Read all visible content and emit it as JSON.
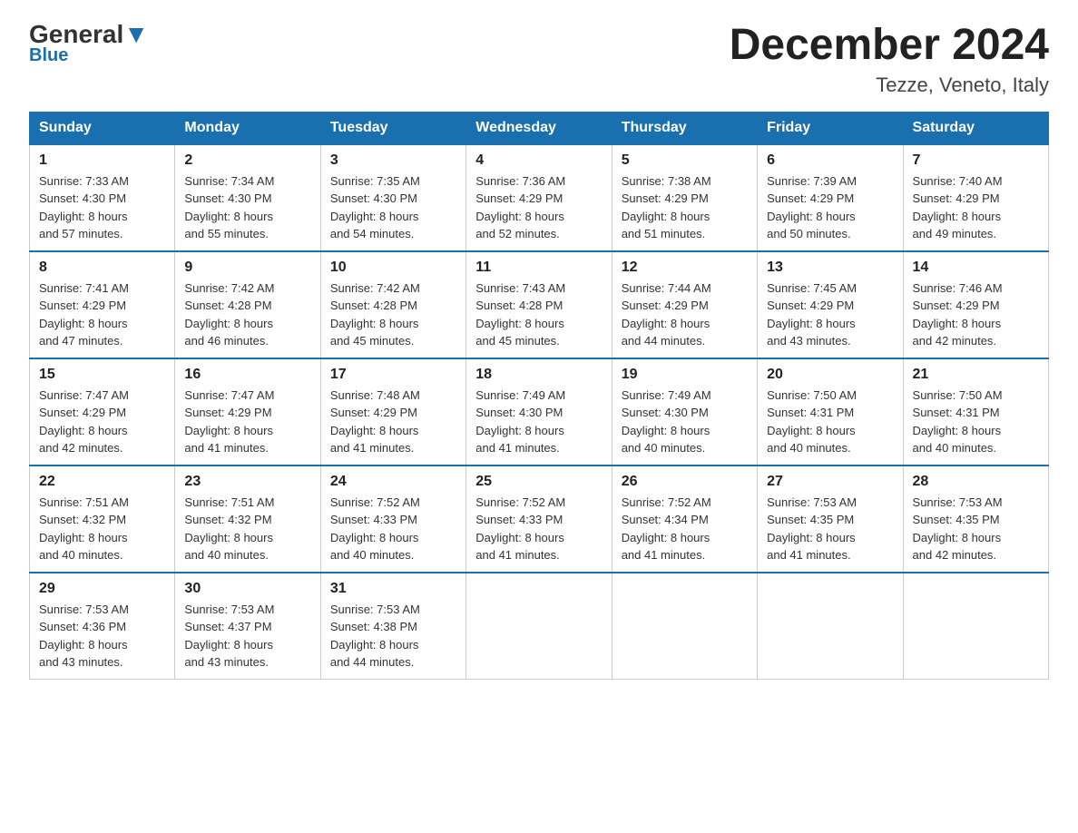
{
  "logo": {
    "general": "General",
    "triangle": "",
    "blue": "Blue"
  },
  "title": "December 2024",
  "location": "Tezze, Veneto, Italy",
  "days_of_week": [
    "Sunday",
    "Monday",
    "Tuesday",
    "Wednesday",
    "Thursday",
    "Friday",
    "Saturday"
  ],
  "weeks": [
    [
      {
        "num": "1",
        "sunrise": "7:33 AM",
        "sunset": "4:30 PM",
        "daylight": "8 hours and 57 minutes."
      },
      {
        "num": "2",
        "sunrise": "7:34 AM",
        "sunset": "4:30 PM",
        "daylight": "8 hours and 55 minutes."
      },
      {
        "num": "3",
        "sunrise": "7:35 AM",
        "sunset": "4:30 PM",
        "daylight": "8 hours and 54 minutes."
      },
      {
        "num": "4",
        "sunrise": "7:36 AM",
        "sunset": "4:29 PM",
        "daylight": "8 hours and 52 minutes."
      },
      {
        "num": "5",
        "sunrise": "7:38 AM",
        "sunset": "4:29 PM",
        "daylight": "8 hours and 51 minutes."
      },
      {
        "num": "6",
        "sunrise": "7:39 AM",
        "sunset": "4:29 PM",
        "daylight": "8 hours and 50 minutes."
      },
      {
        "num": "7",
        "sunrise": "7:40 AM",
        "sunset": "4:29 PM",
        "daylight": "8 hours and 49 minutes."
      }
    ],
    [
      {
        "num": "8",
        "sunrise": "7:41 AM",
        "sunset": "4:29 PM",
        "daylight": "8 hours and 47 minutes."
      },
      {
        "num": "9",
        "sunrise": "7:42 AM",
        "sunset": "4:28 PM",
        "daylight": "8 hours and 46 minutes."
      },
      {
        "num": "10",
        "sunrise": "7:42 AM",
        "sunset": "4:28 PM",
        "daylight": "8 hours and 45 minutes."
      },
      {
        "num": "11",
        "sunrise": "7:43 AM",
        "sunset": "4:28 PM",
        "daylight": "8 hours and 45 minutes."
      },
      {
        "num": "12",
        "sunrise": "7:44 AM",
        "sunset": "4:29 PM",
        "daylight": "8 hours and 44 minutes."
      },
      {
        "num": "13",
        "sunrise": "7:45 AM",
        "sunset": "4:29 PM",
        "daylight": "8 hours and 43 minutes."
      },
      {
        "num": "14",
        "sunrise": "7:46 AM",
        "sunset": "4:29 PM",
        "daylight": "8 hours and 42 minutes."
      }
    ],
    [
      {
        "num": "15",
        "sunrise": "7:47 AM",
        "sunset": "4:29 PM",
        "daylight": "8 hours and 42 minutes."
      },
      {
        "num": "16",
        "sunrise": "7:47 AM",
        "sunset": "4:29 PM",
        "daylight": "8 hours and 41 minutes."
      },
      {
        "num": "17",
        "sunrise": "7:48 AM",
        "sunset": "4:29 PM",
        "daylight": "8 hours and 41 minutes."
      },
      {
        "num": "18",
        "sunrise": "7:49 AM",
        "sunset": "4:30 PM",
        "daylight": "8 hours and 41 minutes."
      },
      {
        "num": "19",
        "sunrise": "7:49 AM",
        "sunset": "4:30 PM",
        "daylight": "8 hours and 40 minutes."
      },
      {
        "num": "20",
        "sunrise": "7:50 AM",
        "sunset": "4:31 PM",
        "daylight": "8 hours and 40 minutes."
      },
      {
        "num": "21",
        "sunrise": "7:50 AM",
        "sunset": "4:31 PM",
        "daylight": "8 hours and 40 minutes."
      }
    ],
    [
      {
        "num": "22",
        "sunrise": "7:51 AM",
        "sunset": "4:32 PM",
        "daylight": "8 hours and 40 minutes."
      },
      {
        "num": "23",
        "sunrise": "7:51 AM",
        "sunset": "4:32 PM",
        "daylight": "8 hours and 40 minutes."
      },
      {
        "num": "24",
        "sunrise": "7:52 AM",
        "sunset": "4:33 PM",
        "daylight": "8 hours and 40 minutes."
      },
      {
        "num": "25",
        "sunrise": "7:52 AM",
        "sunset": "4:33 PM",
        "daylight": "8 hours and 41 minutes."
      },
      {
        "num": "26",
        "sunrise": "7:52 AM",
        "sunset": "4:34 PM",
        "daylight": "8 hours and 41 minutes."
      },
      {
        "num": "27",
        "sunrise": "7:53 AM",
        "sunset": "4:35 PM",
        "daylight": "8 hours and 41 minutes."
      },
      {
        "num": "28",
        "sunrise": "7:53 AM",
        "sunset": "4:35 PM",
        "daylight": "8 hours and 42 minutes."
      }
    ],
    [
      {
        "num": "29",
        "sunrise": "7:53 AM",
        "sunset": "4:36 PM",
        "daylight": "8 hours and 43 minutes."
      },
      {
        "num": "30",
        "sunrise": "7:53 AM",
        "sunset": "4:37 PM",
        "daylight": "8 hours and 43 minutes."
      },
      {
        "num": "31",
        "sunrise": "7:53 AM",
        "sunset": "4:38 PM",
        "daylight": "8 hours and 44 minutes."
      },
      null,
      null,
      null,
      null
    ]
  ],
  "labels": {
    "sunrise": "Sunrise:",
    "sunset": "Sunset:",
    "daylight": "Daylight:"
  }
}
